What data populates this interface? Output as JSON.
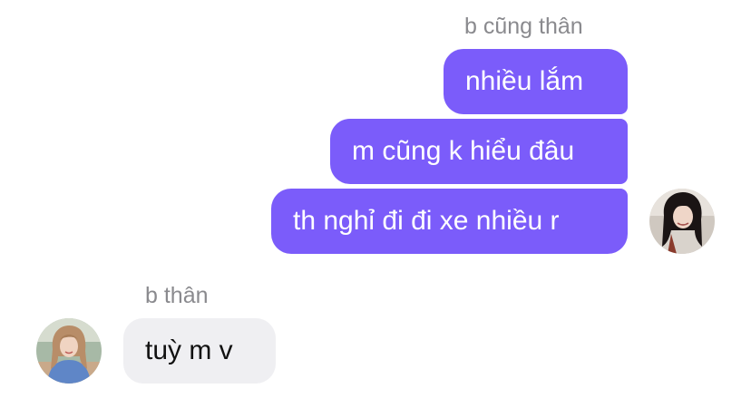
{
  "thread": {
    "outgoing_group": {
      "sender_name": "b cũng thân",
      "messages": [
        "nhiều lắm",
        "m cũng k hiểu đâu",
        "th nghỉ đi đi xe nhiều r"
      ],
      "avatar_icon": "user-avatar-icon"
    },
    "incoming_group": {
      "sender_name": "b thân",
      "messages": [
        "tuỳ m v"
      ],
      "avatar_icon": "contact-avatar-icon"
    }
  },
  "colors": {
    "outgoing_bubble": "#7b5cfa",
    "incoming_bubble": "#efeff2",
    "sender_name_text": "#8a8a8e"
  }
}
